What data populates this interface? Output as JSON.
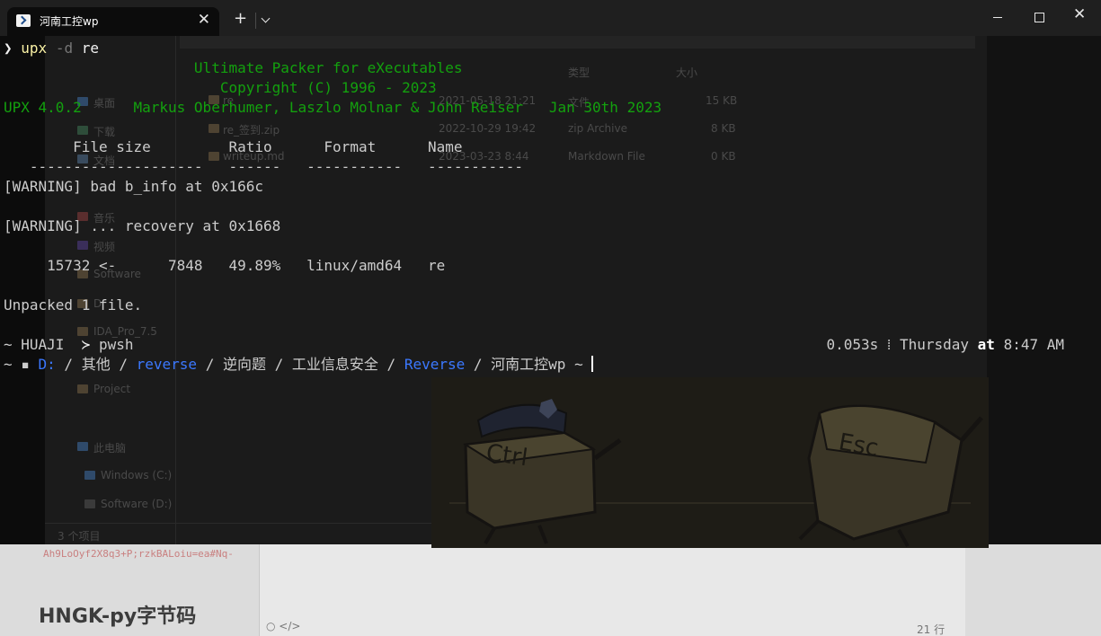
{
  "window": {
    "tab_title": "河南工控wp",
    "tab_close": "✕",
    "new_tab": "+",
    "minimize": "—",
    "maximize": "☐",
    "close": "✕"
  },
  "background": {
    "column_type": "类型",
    "column_size": "大小",
    "rows": [
      {
        "name": "re",
        "date": "2021-05-18 21:21",
        "type": "文件",
        "size": "15 KB"
      },
      {
        "name": "re_签到.zip",
        "date": "2022-10-29 19:42",
        "type": "zip Archive",
        "size": "8 KB"
      },
      {
        "name": "writeup.md",
        "date": "2023-03-23 8:44",
        "type": "Markdown File",
        "size": "0 KB"
      }
    ],
    "sidebar": [
      "桌面",
      "下载",
      "文档",
      "音乐",
      "视频",
      "Software",
      "D",
      "IDA_Pro_7.5",
      "Project",
      "此电脑",
      "Windows (C:)",
      "Software (D:)"
    ],
    "item_count": "3 个项目",
    "red_text": "Ah9LoOyf2X8q3+P;rzkBALoiu=ea#Nq-",
    "heading": "HNGK-py字节码",
    "line_count": "21 行"
  },
  "terminal": {
    "prompt_symbol": "❯",
    "cmd_name": "upx",
    "cmd_flag": " -d",
    "cmd_arg": " re",
    "banner1": "                      Ultimate Packer for eXecutables",
    "banner2": "                         Copyright (C) 1996 - 2023",
    "banner3": "UPX 4.0.2      Markus Oberhumer, Laszlo Molnar & John Reiser   Jan 30th 2023",
    "header": "        File size         Ratio      Format      Name",
    "dashes": "   --------------------   ------   -----------   -----------",
    "warn1": "[WARNING] bad b_info at 0x166c",
    "warn2": "[WARNING] ... recovery at 0x1668",
    "result": "     15732 <-      7848   49.89%   linux/amd64   re",
    "unpacked": "Unpacked 1 file.",
    "status_left_tilde": "~ ",
    "status_user": "HUAJI",
    "status_shell_icon": "  ≻ ",
    "status_shell": "pwsh",
    "status_time": "0.053s",
    "status_sep": " ⁞ ",
    "status_day": "Thursday",
    "status_at": " at ",
    "status_clock": "8:47 AM",
    "path_prefix": "~ ▪ ",
    "path_drive": "D:",
    "path_sep1": " / ",
    "path_part1": "其他",
    "path_sep2": " / ",
    "path_part2": "reverse",
    "path_sep3": " / ",
    "path_part3": "逆向题",
    "path_sep4": " / ",
    "path_part4": "工业信息安全",
    "path_sep5": " / ",
    "path_part5": "Reverse",
    "path_sep6": " / ",
    "path_part6": "河南工控wp",
    "path_suffix": " ~ "
  }
}
